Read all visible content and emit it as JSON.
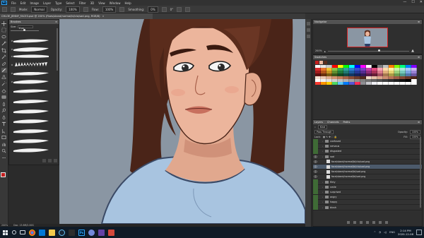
{
  "app": {
    "logo": "Ps",
    "menu": [
      "File",
      "Edit",
      "Image",
      "Layer",
      "Type",
      "Select",
      "Filter",
      "3D",
      "View",
      "Window",
      "Help"
    ],
    "window_controls": [
      "—",
      "☐",
      "✕"
    ]
  },
  "options_bar": {
    "mode_label": "Mode:",
    "mode_value": "Normal",
    "opacity_label": "Opacity:",
    "opacity_value": "100%",
    "flow_label": "Flow:",
    "flow_value": "100%",
    "smoothing_label": "Smoothing:",
    "smoothing_value": "0%",
    "angle_value": "0°"
  },
  "document": {
    "tab_title": "CHLOE_JENNY_FACE3.psd @ 200% (Fixes/stand/normal/bl/clo/sad.png, RGB/8)",
    "close": "×"
  },
  "brushes_panel": {
    "title": "Brushes",
    "size_label": "Size:",
    "size_value": "6 px"
  },
  "status": {
    "zoom": "200%",
    "doc_size": "Doc: 13.6M/2.00G"
  },
  "navigator": {
    "title": "Navigator",
    "zoom": "200%"
  },
  "swatches": {
    "title": "Swatches",
    "rows": [
      [
        "#ffffff",
        "#e6e6e6",
        "#c8c8c8",
        "#ff0000",
        "#ffff00",
        "#00ff00",
        "#00ffff",
        "#0000ff",
        "#ff00ff",
        "#ffffff",
        "#000000",
        "#808080",
        "#c0c0c0",
        "#ff8000",
        "#80ff00",
        "#00ff80",
        "#0080ff",
        "#8000ff"
      ],
      [
        "#d92b2b",
        "#e6732a",
        "#f0c02e",
        "#8bc34a",
        "#32a852",
        "#2fa39b",
        "#2a7fd4",
        "#3a4fc9",
        "#7b3fc4",
        "#c43fa6",
        "#e04a7b",
        "#f5a3b3",
        "#fcd9a8",
        "#fff2a1",
        "#c9f0a8",
        "#a6e8dd",
        "#a8c9f5",
        "#c7b3f0"
      ],
      [
        "#a11c1c",
        "#b3541a",
        "#c49320",
        "#5f8f2f",
        "#1f7a3a",
        "#1f7a73",
        "#1d5a9e",
        "#263896",
        "#562b91",
        "#912b7a",
        "#a83258",
        "#d97a8c",
        "#e0b07a",
        "#e6d36f",
        "#9ad07a",
        "#76c9bb",
        "#7aa3e0",
        "#9a82d4"
      ],
      [
        "#5c0f0f",
        "#6b310e",
        "#7a5b12",
        "#3a5a1c",
        "#124a22",
        "#124a46",
        "#123763",
        "#17215c",
        "#341a5a",
        "#5a1a4b",
        "#681e36",
        "#a34f60",
        "#a67a4f",
        "#ab9b46",
        "#6a9a4f",
        "#4f9a8d",
        "#4f77ad",
        "#6d57a3"
      ],
      [
        "#f4e0d0",
        "#ecc8b0",
        "#e0ad8f",
        "#d4936f",
        "#c07a58",
        "#a86246",
        "#8c4c36",
        "#6e3a2a",
        "#52291e",
        "#f0d8c8",
        "#e6c0a8",
        "#dca68c",
        "#cc8c70",
        "#b87458",
        "#a05e46",
        "#864a36",
        "#6a3828",
        "#4e281c"
      ],
      [
        "#ffffff",
        "#f0f0f0",
        "#e0e0e0",
        "#d0d0d0",
        "#c0c0c0",
        "#b0b0b0",
        "#a0a0a0",
        "#909090",
        "#808080",
        "#707070",
        "#606060",
        "#505050",
        "#404040",
        "#303030",
        "#202020",
        "#101010",
        "#000000",
        "#ffffff"
      ],
      [
        "#ff3b30",
        "#ff9500",
        "#ffcc00",
        "#4cd964",
        "#5ac8fa",
        "#007aff",
        "#5856d6",
        "#ff2d55",
        "#8e8e93",
        "#c7c7cc",
        "#efeff4",
        "#ffffff",
        "#ffffff",
        "#ffffff",
        "#ffffff",
        "#ffffff",
        "#ffffff",
        "#ffffff"
      ]
    ]
  },
  "layers": {
    "tabs": [
      "Layers",
      "Channels",
      "Paths"
    ],
    "kind_label": "Kind",
    "blend_mode": "Pass Through",
    "opacity_label": "Opacity:",
    "opacity_value": "100%",
    "fill_label": "Fill:",
    "fill_value": "100%",
    "lock_label": "Lock:",
    "items": [
      {
        "name": "confused",
        "type": "folder",
        "indent": 1,
        "visible": false,
        "selected": false
      },
      {
        "name": "nervous",
        "type": "folder",
        "indent": 1,
        "visible": false,
        "selected": false
      },
      {
        "name": "disgusted",
        "type": "folder",
        "indent": 1,
        "visible": false,
        "selected": false
      },
      {
        "name": "sad",
        "type": "folder",
        "indent": 1,
        "visible": true,
        "selected": false
      },
      {
        "name": "face/stand/normal/bl/clo/sad.png",
        "type": "layer",
        "indent": 2,
        "visible": true,
        "selected": false
      },
      {
        "name": "face/stand/normal/bl/clo/sad.png",
        "type": "layer",
        "indent": 2,
        "visible": true,
        "selected": true
      },
      {
        "name": "face/stand/normal/bl/sad.png",
        "type": "layer",
        "indent": 2,
        "visible": true,
        "selected": false
      },
      {
        "name": "face/stand/normal/bl/sad.png",
        "type": "layer",
        "indent": 2,
        "visible": true,
        "selected": false
      },
      {
        "name": "flirty",
        "type": "folder",
        "indent": 1,
        "visible": false,
        "selected": false
      },
      {
        "name": "smile",
        "type": "folder",
        "indent": 1,
        "visible": false,
        "selected": false
      },
      {
        "name": "surprised",
        "type": "folder",
        "indent": 1,
        "visible": false,
        "selected": false
      },
      {
        "name": "angry",
        "type": "folder",
        "indent": 1,
        "visible": false,
        "selected": false
      },
      {
        "name": "happy",
        "type": "folder",
        "indent": 1,
        "visible": false,
        "selected": false
      },
      {
        "name": "blush",
        "type": "folder",
        "indent": 1,
        "visible": false,
        "selected": false
      }
    ]
  },
  "taskbar": {
    "ps_label": "Ps",
    "tray_lang": "ENG",
    "time": "2:14 PM",
    "date": "2020-12-08"
  },
  "colors": {
    "foreground": "#c41f1f",
    "background": "#f2f2f2",
    "canvas_bg": "#8a96a3",
    "accent": "#31a8ff"
  }
}
